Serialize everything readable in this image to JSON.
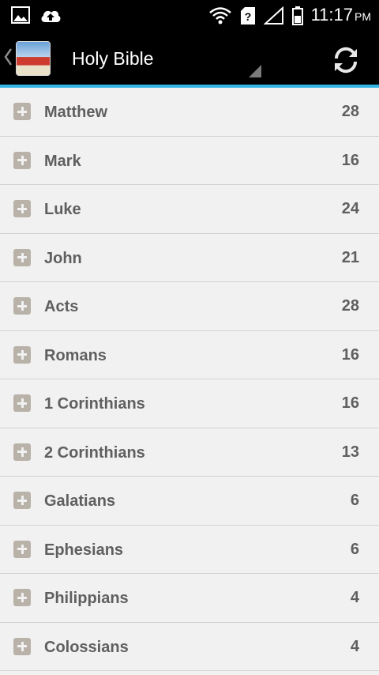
{
  "status_bar": {
    "time": "11:17",
    "ampm": "PM",
    "icons": [
      "image-icon",
      "cloud-upload-icon",
      "wifi-icon",
      "no-sim-icon",
      "signal-icon",
      "battery-icon"
    ]
  },
  "action_bar": {
    "title": "Holy Bible",
    "icons": [
      "back-chevron-icon",
      "app-icon",
      "spinner-indicator-icon",
      "refresh-icon"
    ]
  },
  "books": [
    {
      "name": "Matthew",
      "chapters": "28"
    },
    {
      "name": "Mark",
      "chapters": "16"
    },
    {
      "name": "Luke",
      "chapters": "24"
    },
    {
      "name": "John",
      "chapters": "21"
    },
    {
      "name": "Acts",
      "chapters": "28"
    },
    {
      "name": "Romans",
      "chapters": "16"
    },
    {
      "name": "1 Corinthians",
      "chapters": "16"
    },
    {
      "name": "2 Corinthians",
      "chapters": "13"
    },
    {
      "name": "Galatians",
      "chapters": "6"
    },
    {
      "name": "Ephesians",
      "chapters": "6"
    },
    {
      "name": "Philippians",
      "chapters": "4"
    },
    {
      "name": "Colossians",
      "chapters": "4"
    }
  ],
  "colors": {
    "accent": "#33b5e5",
    "text": "#5f5f5f",
    "background": "#f1f1f1",
    "expand_icon": "#b9b2a9"
  }
}
